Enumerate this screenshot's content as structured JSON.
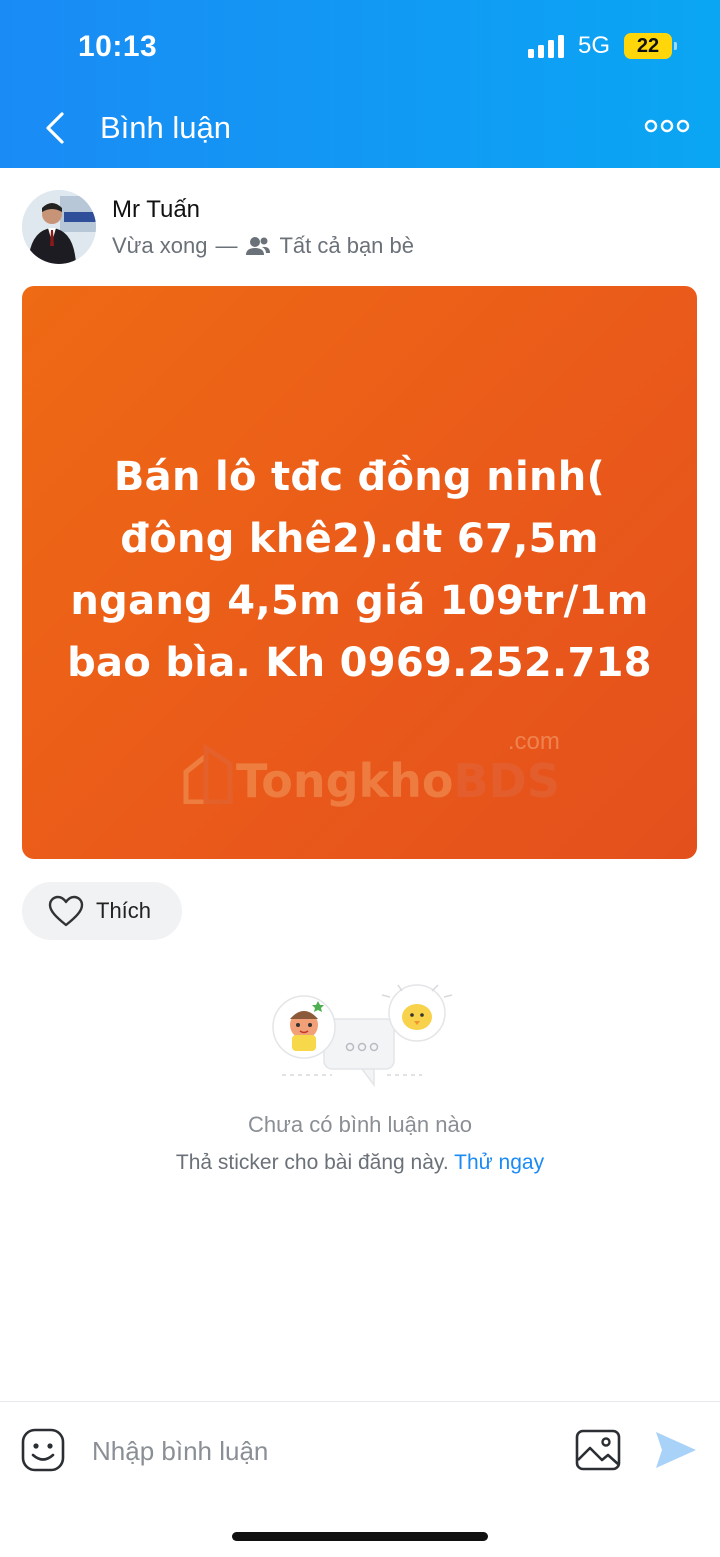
{
  "status_bar": {
    "time": "10:13",
    "network": "5G",
    "battery": "22"
  },
  "header": {
    "title": "Bình luận"
  },
  "post": {
    "author": "Mr Tuấn",
    "time": "Vừa xong",
    "separator": "—",
    "audience": "Tất cả bạn bè",
    "body": "Bán lô tđc đồng ninh( đông khê2).dt 67,5m ngang 4,5m giá 109tr/1m bao bìa. Kh 0969.252.718",
    "watermark": {
      "prefix": "Tongkho",
      "suffix": "BDS",
      "domain": ".com"
    },
    "background_colors": [
      "#ee6a14",
      "#e4501c"
    ]
  },
  "like": {
    "label": "Thích"
  },
  "empty_state": {
    "title": "Chưa có bình luận nào",
    "subtitle": "Thả sticker cho bài đăng này.",
    "link": "Thử ngay"
  },
  "comment_bar": {
    "placeholder": "Nhập bình luận"
  },
  "colors": {
    "accent": "#1a8bf5",
    "header_end": "#0aa6f3"
  }
}
